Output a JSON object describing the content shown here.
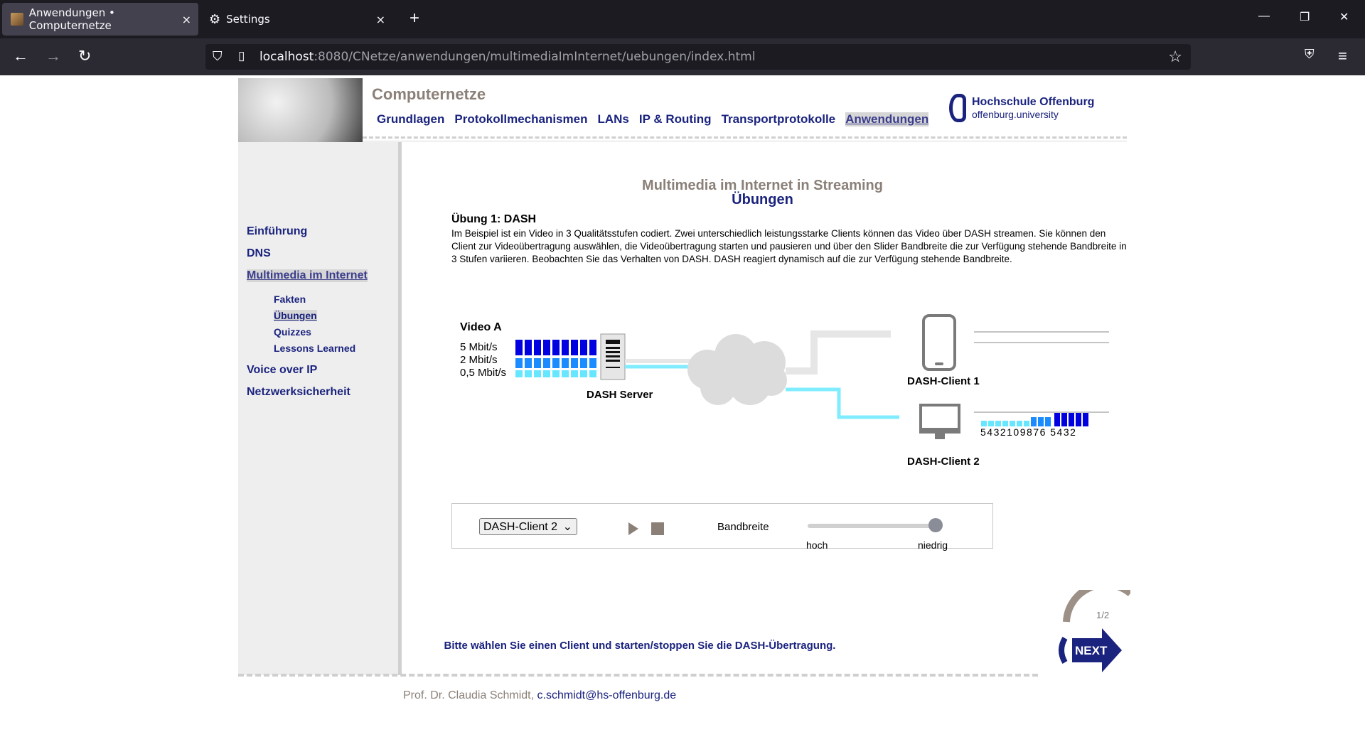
{
  "browser": {
    "tabs": [
      {
        "title": "Anwendungen • Computernetze"
      },
      {
        "title": "Settings"
      }
    ],
    "url_host": "localhost",
    "url_rest": ":8080/CNetze/anwendungen/multimediaImInternet/uebungen/index.html"
  },
  "site": {
    "title": "Computernetze",
    "topnav": [
      "Grundlagen",
      "Protokollmechanismen",
      "LANs",
      "IP & Routing",
      "Transportprotokolle",
      "Anwendungen"
    ],
    "logo_line1": "Hochschule Offenburg",
    "logo_line2": "offenburg.university"
  },
  "sidebar": {
    "items": [
      "Einführung",
      "DNS",
      "Multimedia im Internet",
      "Voice over IP",
      "Netzwerksicherheit"
    ],
    "subitems": [
      "Fakten",
      "Übungen",
      "Quizzes",
      "Lessons Learned"
    ]
  },
  "main": {
    "title": "Multimedia im Internet in Streaming",
    "subtitle": "Übungen",
    "exercise_title": "Übung 1: DASH",
    "exercise_text": "Im Beispiel ist ein Video in 3 Qualitätsstufen codiert. Zwei unterschiedlich leistungsstarke Clients können das Video über DASH streamen. Sie können den Client zur Videoübertragung auswählen, die Videoübertragung starten und pausieren und über den Slider Bandbreite die zur Verfügung stehende Bandbreite in 3 Stufen variieren. Beobachten Sie das Verhalten von DASH. DASH reagiert dynamisch auf die zur Verfügung stehende Bandbreite."
  },
  "diagram": {
    "video_label": "Video A",
    "rates": [
      "5 Mbit/s",
      "2 Mbit/s",
      "0,5 Mbit/s"
    ],
    "server_label": "DASH Server",
    "client1_label": "DASH-Client 1",
    "client2_label": "DASH-Client 2",
    "buffer_numbers": "5432109876 5432"
  },
  "controls": {
    "client_select": "DASH-Client 2",
    "bandwidth_label": "Bandbreite",
    "slider_low": "hoch",
    "slider_high": "niedrig"
  },
  "bottom_note": "Bitte wählen Sie einen Client und starten/stoppen Sie die DASH-Übertragung.",
  "next": {
    "page": "1/2",
    "label": "NEXT"
  },
  "footer": {
    "author": "Prof. Dr. Claudia Schmidt,",
    "email": "c.schmidt@hs-offenburg.de"
  }
}
